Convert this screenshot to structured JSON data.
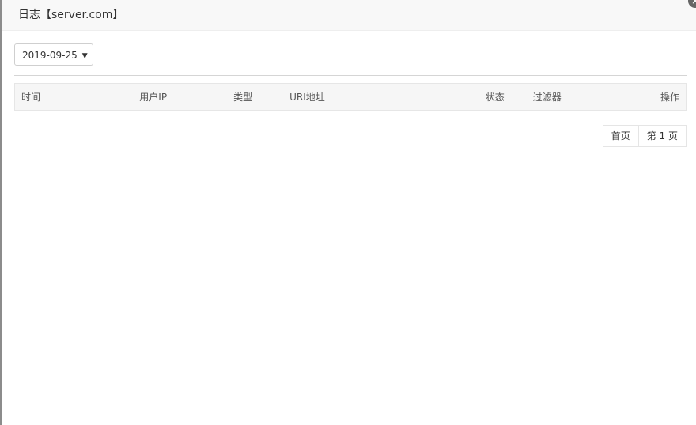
{
  "dialog": {
    "title": "日志【server.com】",
    "close_glyph": "×"
  },
  "filter": {
    "date_value": "2019-09-25",
    "caret": "▼"
  },
  "table": {
    "columns": [
      "时间",
      "用户IP",
      "类型",
      "URI地址",
      "状态",
      "过滤器",
      "操作"
    ]
  },
  "pager": {
    "first_label": "首页",
    "current_label": "第 1 页"
  },
  "icons": {
    "close": "close-icon",
    "dropdown": "chevron-down-icon"
  }
}
